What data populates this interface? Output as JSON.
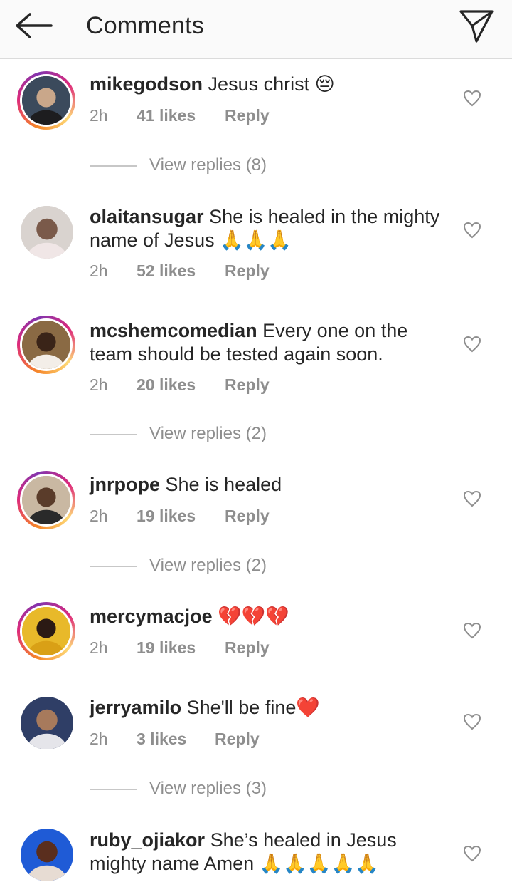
{
  "header": {
    "title": "Comments",
    "back_icon": "arrow-left-icon",
    "share_icon": "send-icon"
  },
  "comments": [
    {
      "username": "mikegodson",
      "text": "Jesus christ 😔",
      "time": "2h",
      "likes": "41 likes",
      "reply": "Reply",
      "view_replies": "View replies (8)",
      "avatar_colors": [
        "#3b4a5c",
        "#c9a78a",
        "#1d1d1f"
      ]
    },
    {
      "username": "olaitansugar",
      "text": "She is healed in the mighty name of Jesus 🙏🙏🙏",
      "time": "2h",
      "likes": "52 likes",
      "reply": "Reply",
      "view_replies": "",
      "avatar_colors": [
        "#d9d3cf",
        "#7a5a4a",
        "#f0e6e6"
      ]
    },
    {
      "username": "mcshemcomedian",
      "text": "Every one on the team should be tested again soon.",
      "time": "2h",
      "likes": "20 likes",
      "reply": "Reply",
      "view_replies": "View replies (2)",
      "avatar_colors": [
        "#8a6a44",
        "#3a2418",
        "#f3eee8"
      ]
    },
    {
      "username": "jnrpope",
      "text": "She is healed",
      "time": "2h",
      "likes": "19 likes",
      "reply": "Reply",
      "view_replies": "View replies (2)",
      "avatar_colors": [
        "#c9b8a2",
        "#5a3c2a",
        "#2a2a2a"
      ]
    },
    {
      "username": "mercymacjoe",
      "text": "💔💔💔",
      "time": "2h",
      "likes": "19 likes",
      "reply": "Reply",
      "view_replies": "",
      "avatar_colors": [
        "#e8b92a",
        "#2b1a14",
        "#d9a016"
      ]
    },
    {
      "username": "jerryamilo",
      "text": "She'll be fine❤️",
      "time": "2h",
      "likes": "3 likes",
      "reply": "Reply",
      "view_replies": "View replies (3)",
      "avatar_colors": [
        "#2f3e66",
        "#a77a5c",
        "#e5e5ea"
      ]
    },
    {
      "username": "ruby_ojiakor",
      "text": "She’s healed in Jesus mighty name Amen 🙏🙏🙏🙏🙏",
      "time": "",
      "likes": "",
      "reply": "",
      "view_replies": "",
      "avatar_colors": [
        "#1f5bd6",
        "#5a2e1e",
        "#e7dcd3"
      ]
    }
  ]
}
